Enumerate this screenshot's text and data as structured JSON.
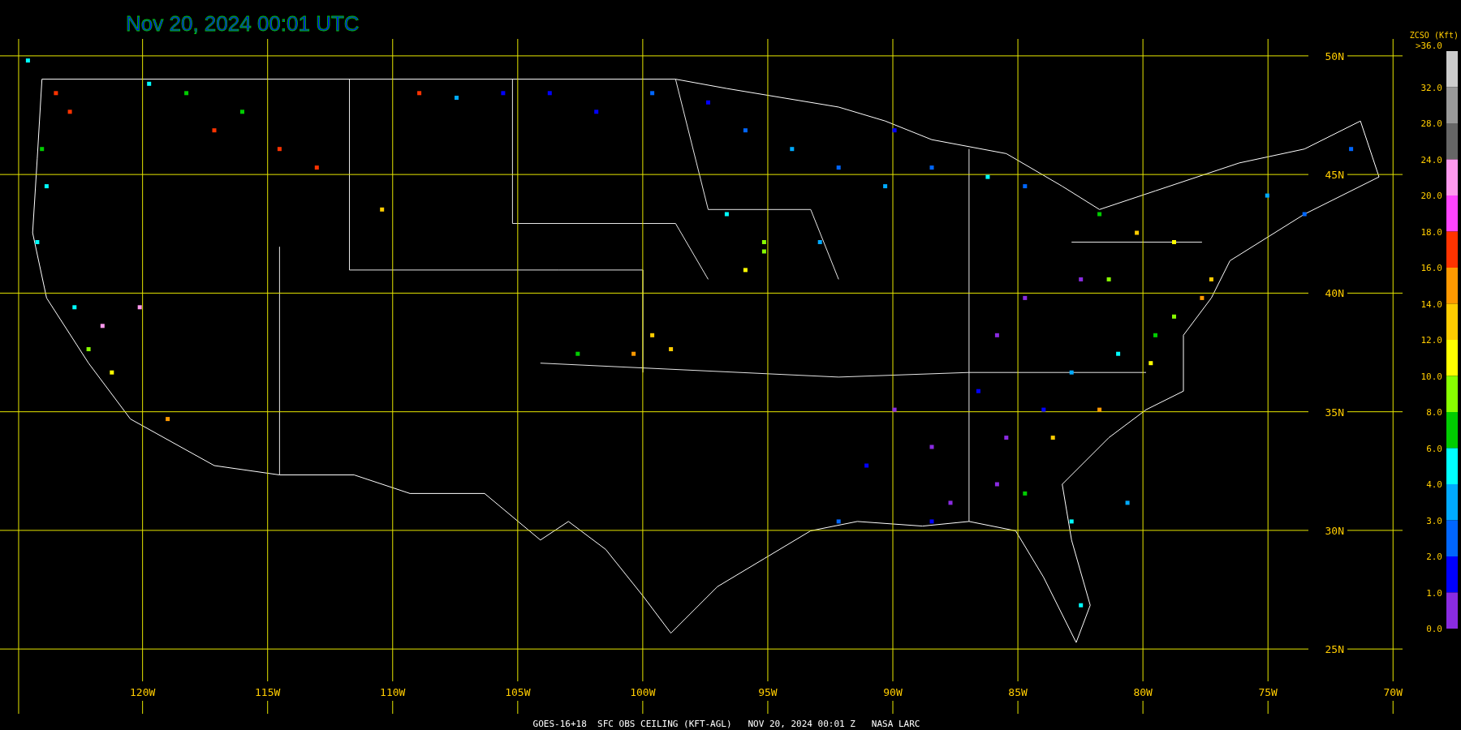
{
  "title": "Nov 20, 2024 00:01 UTC",
  "map": {
    "longitude_labels": [
      "120W",
      "115W",
      "110W",
      "105W",
      "100W",
      "95W",
      "90W",
      "85W",
      "80W",
      "75W",
      "70W"
    ],
    "latitude_labels": [
      "50N",
      "45N",
      "40N",
      "35N",
      "30N",
      "25N"
    ]
  },
  "legend": {
    "title": "ZCSO (Kft)",
    "tick_labels": [
      ">36.0",
      "32.0",
      "28.0",
      "24.0",
      "20.0",
      "18.0",
      "16.0",
      "14.0",
      "12.0",
      "10.0",
      "8.0",
      "6.0",
      "4.0",
      "3.0",
      "2.0",
      "1.0",
      "0.0"
    ],
    "segments": [
      {
        "color": "#cccccc"
      },
      {
        "color": "#999999"
      },
      {
        "color": "#666666"
      },
      {
        "color": "#ff99ee"
      },
      {
        "color": "#ff44ff"
      },
      {
        "color": "#ff3300"
      },
      {
        "color": "#ff9900"
      },
      {
        "color": "#ffcc00"
      },
      {
        "color": "#ffff00"
      },
      {
        "color": "#88ff00"
      },
      {
        "color": "#00cc00"
      },
      {
        "color": "#00ffff"
      },
      {
        "color": "#00aaff"
      },
      {
        "color": "#0066ff"
      },
      {
        "color": "#0000ff"
      },
      {
        "color": "#8a2be2"
      }
    ]
  },
  "caption": "GOES-16+18  SFC OBS CEILING (KFT-AGL)   NOV 20, 2024 00:01 Z   NASA LARC"
}
